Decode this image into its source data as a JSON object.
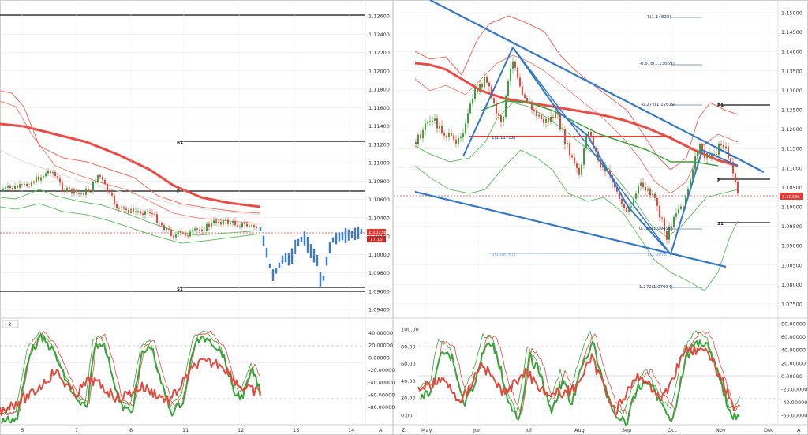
{
  "colors": {
    "green": "#3aa33a",
    "red": "#e24a3e",
    "blue": "#3a7bd5",
    "trend": "#3377c7",
    "band_red": "#ef6b60",
    "band_green": "#6bbf6b",
    "ma": "#e94b45",
    "grid": "#e6e6e6"
  },
  "left": {
    "price_ticks": [
      "1.12600",
      "1.12400",
      "1.12200",
      "1.12000",
      "1.11800",
      "1.11600",
      "1.11400",
      "1.11200",
      "1.11000",
      "1.10800",
      "1.10600",
      "1.10400",
      "1.10200",
      "1.10000",
      "1.09800",
      "1.09600",
      "1.09400"
    ],
    "price_tag": "1.10236",
    "time_tag": "17:15",
    "labels": {
      "r1": "R1",
      "p": "P",
      "s1": "S1"
    },
    "osc_header": "2",
    "osc_ticks": [
      "40.00000",
      "20.00000",
      "0.00000",
      "-20.00000",
      "-40.00000",
      "-60.00000",
      "-80.00000"
    ],
    "x_ticks": [
      "6",
      "7",
      "8",
      "11",
      "12",
      "13",
      "14"
    ],
    "corner": "A"
  },
  "right": {
    "price_ticks": [
      "1.15000",
      "1.14500",
      "1.14000",
      "1.13500",
      "1.13000",
      "1.12500",
      "1.12000",
      "1.11500",
      "1.11000",
      "1.10500",
      "1.10000",
      "1.09500",
      "1.09000",
      "1.08500",
      "1.08000",
      "1.07500"
    ],
    "price_tag": "1.10236",
    "labels": {
      "r1": "R1",
      "p": "P",
      "s1": "S1"
    },
    "fib_levels": [
      "-1(1.14828)",
      "-0.618(1.13669)",
      "-0.272(1.12619)",
      "0.786(1.09496)",
      "1.272(1.07934)"
    ],
    "fib_light": [
      "1(1.11782)",
      "0(1.08767)",
      "1(1.08767)"
    ],
    "osc_left_ticks": [
      "100.00",
      "80.00",
      "60.00",
      "40.00",
      "20.00",
      "0.00"
    ],
    "osc_right_ticks": [
      "80.00000",
      "60.00000",
      "40.00000",
      "20.00000",
      "0.00000",
      "-20.00000",
      "-40.00000",
      "-60.00000"
    ],
    "x_ticks": [
      "May",
      "Jun",
      "Jul",
      "Aug",
      "Sep",
      "Oct",
      "Nov",
      "Dec"
    ],
    "corner_left": "Z",
    "corner_right": "A"
  }
}
